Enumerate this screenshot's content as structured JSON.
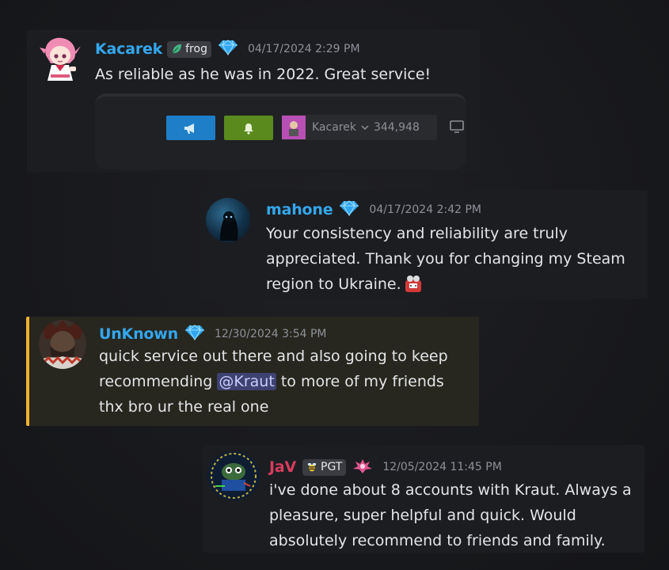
{
  "messages": [
    {
      "user": "Kacarek",
      "user_color": "#33a7ee",
      "tag": "frog",
      "timestamp": "04/17/2024 2:29 PM",
      "lines": [
        "As reliable as he was in 2022. Great service!"
      ],
      "embed": {
        "profile_name": "Kacarek",
        "balance": "344,948",
        "btn_colors": [
          "#1e7fc8",
          "#5a8a1e"
        ]
      }
    },
    {
      "user": "mahone",
      "user_color": "#33a7ee",
      "timestamp": "04/17/2024 2:42 PM",
      "lines": [
        "Your consistency and reliability are truly",
        "appreciated. Thank you for changing my Steam",
        "region to Ukraine."
      ]
    },
    {
      "user": "UnKnown",
      "user_color": "#33a7ee",
      "timestamp": "12/30/2024 3:54 PM",
      "line1": "quick service out there and also going to keep",
      "line2_pre": "recommending ",
      "mention": "@Kraut",
      "line2_post": " to more of my friends",
      "line3": "thx bro ur the real one",
      "accent_color": "#f0b232"
    },
    {
      "user": "JaV",
      "user_color": "#d63d5e",
      "tag": "PGT",
      "timestamp": "12/05/2024 11:45 PM",
      "lines": [
        "i've done about 8 accounts with Kraut. Always a",
        "pleasure, super helpful and quick. Would",
        "absolutely recommend to friends and family."
      ]
    }
  ]
}
